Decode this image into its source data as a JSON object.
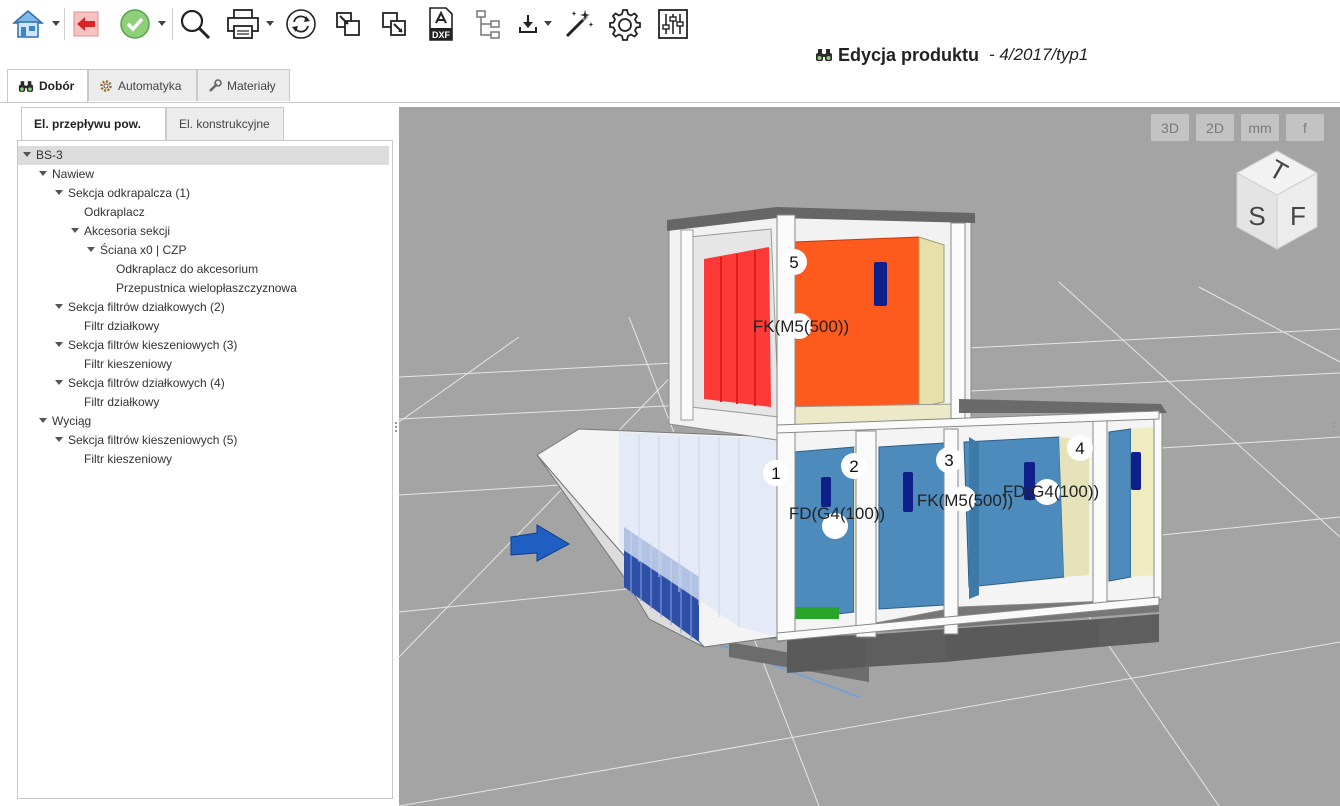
{
  "toolbar": {
    "icons": [
      "home-icon",
      "back-icon",
      "ok-icon",
      "search-icon",
      "printer-icon",
      "refresh-icon",
      "collapse-icon",
      "expand-icon",
      "dxf-icon",
      "hierarchy-icon",
      "download-icon",
      "magic-wand-icon",
      "gear-icon",
      "sliders-icon"
    ],
    "dxf_label": "DXF"
  },
  "title": {
    "main": "Edycja produktu",
    "sub": "- 4/2017/typ1"
  },
  "main_tabs": [
    {
      "label": "Dobór",
      "icon": "binoculars-icon",
      "active": true
    },
    {
      "label": "Automatyka",
      "icon": "gear-icon",
      "active": false
    },
    {
      "label": "Materiały",
      "icon": "wrench-icon",
      "active": false
    }
  ],
  "sub_tabs": [
    {
      "label": "El. przepływu pow.",
      "active": true
    },
    {
      "label": "El. konstrukcyjne",
      "active": false
    }
  ],
  "tree": [
    {
      "label": "BS-3",
      "level": 0,
      "expanded": true,
      "selected": true
    },
    {
      "label": "Nawiew",
      "level": 1,
      "expanded": true
    },
    {
      "label": "Sekcja odkrapalcza (1)",
      "level": 2,
      "expanded": true
    },
    {
      "label": "Odkraplacz",
      "level": 3
    },
    {
      "label": "Akcesoria sekcji",
      "level": 3,
      "expanded": true
    },
    {
      "label": "Ściana x0 | CZP",
      "level": 4,
      "expanded": true
    },
    {
      "label": "Odkraplacz do akcesorium",
      "level": 5
    },
    {
      "label": "Przepustnica wielopłaszczyznowa",
      "level": 5
    },
    {
      "label": "Sekcja filtrów działkowych (2)",
      "level": 2,
      "expanded": true
    },
    {
      "label": "Filtr działkowy",
      "level": 3
    },
    {
      "label": "Sekcja filtrów kieszeniowych (3)",
      "level": 2,
      "expanded": true
    },
    {
      "label": "Filtr kieszeniowy",
      "level": 3
    },
    {
      "label": "Sekcja filtrów działkowych (4)",
      "level": 2,
      "expanded": true
    },
    {
      "label": "Filtr działkowy",
      "level": 3
    },
    {
      "label": "Wyciąg",
      "level": 1,
      "expanded": true
    },
    {
      "label": "Sekcja filtrów kieszeniowych (5)",
      "level": 2,
      "expanded": true
    },
    {
      "label": "Filtr kieszeniowy",
      "level": 3
    }
  ],
  "viewport": {
    "buttons": [
      "3D",
      "2D",
      "mm",
      "f"
    ],
    "cube_faces": {
      "top": "T",
      "left": "S",
      "right": "F"
    },
    "section_numbers": [
      "1",
      "2",
      "3",
      "4",
      "5"
    ],
    "labels": [
      "FK(M5(500))",
      "FD(G4(100))",
      "FK(M5(500))",
      "FD(G4(100))"
    ]
  },
  "colors": {
    "viewport_bg": "#a4a4a4",
    "filter_blue": "#4d8bbd",
    "filter_orange": "#ff5a1e",
    "filter_red": "#ff3333",
    "arrow_blue": "#1f5fc2",
    "toolbar_icon_blue": "#3a86c8"
  }
}
